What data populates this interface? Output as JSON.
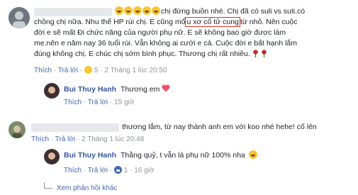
{
  "comment1": {
    "line1_suffix": "chị đừng buồn nhé. Chị đã có suli vs suti.có",
    "line2": "chồng chị nữa. Nhu thế HP rùi chị. E cũng mổ",
    "line2_highlight": "u xơ cổ tử cung",
    "line2_suffix": "từ nhỏ. Nên cuộc",
    "line3": "đời e sẽ mất Đi chức năng của người phụ nữ. E sẽ không bao giờ được làm",
    "line4": "mẹ.nên e năm nay 36 tuổi rùi. Vẫn không ai cưới e cả. Cuộc đời e bất hạnh lắm",
    "line5": "đúng không chị. E chúc chị sớm bình phục. Thương chị rất nhiều.",
    "like": "Thích",
    "reply": "Trả lời",
    "reactions": "5",
    "time": "2 Tháng 1 lúc 20:50"
  },
  "reply1": {
    "author": "Bui Thuy Hanh",
    "text": "Thương em",
    "like": "Thích",
    "reply": "Trả lời",
    "likes": "15 giờ"
  },
  "comment2": {
    "text": "thương lắm, từ nay thành anh em với koo nhé hehe! cố lên",
    "like": "Thích",
    "reply": "Trả lời",
    "time": "2 Tháng 1 lúc 20:48"
  },
  "reply2": {
    "author": "Bui Thuy Hanh",
    "text": "Thằng quỷ, t vẫn là phụ nữ 100% nha",
    "like": "Thích",
    "reply": "Trả lời",
    "likes": "1",
    "time": "16 giờ"
  },
  "more_replies": "Xem phản hồi khác",
  "colors": {
    "link": "#4267b2",
    "highlight": "#e0312b",
    "meta": "#90949c"
  }
}
